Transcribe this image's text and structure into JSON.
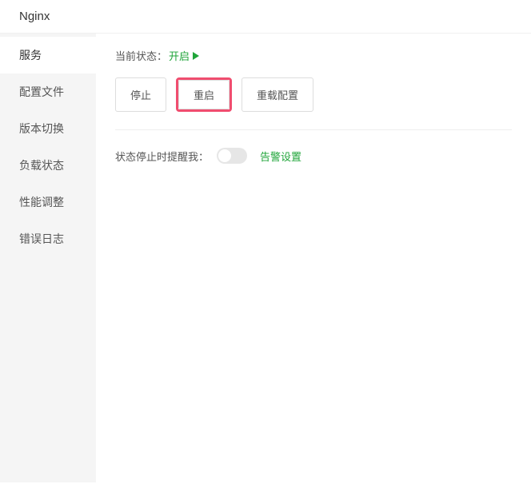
{
  "header": {
    "title": "Nginx"
  },
  "sidebar": {
    "items": [
      {
        "label": "服务"
      },
      {
        "label": "配置文件"
      },
      {
        "label": "版本切换"
      },
      {
        "label": "负载状态"
      },
      {
        "label": "性能调整"
      },
      {
        "label": "错误日志"
      }
    ]
  },
  "status": {
    "label": "当前状态：",
    "value": "开启"
  },
  "buttons": {
    "stop": "停止",
    "restart": "重启",
    "reload": "重载配置"
  },
  "notify": {
    "label": "状态停止时提醒我：",
    "alert_link": "告警设置"
  }
}
